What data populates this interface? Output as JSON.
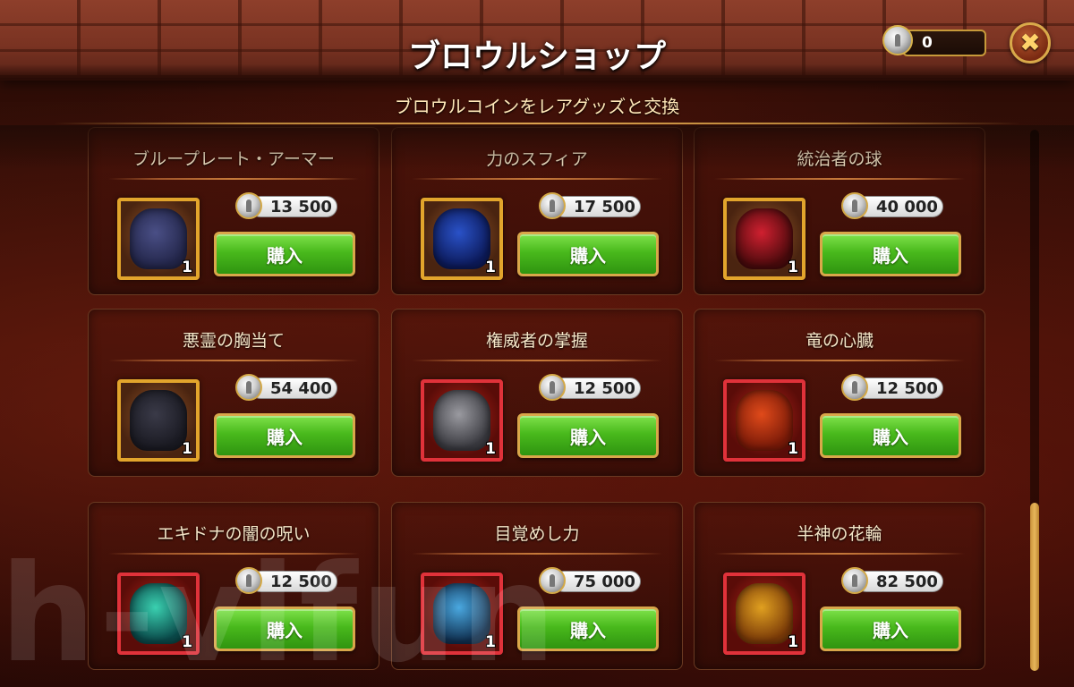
{
  "header": {
    "title": "ブロウルショップ",
    "subtitle": "ブロウルコインをレアグッズと交換",
    "coin_balance": "0",
    "close_icon": "close-icon",
    "colors": {
      "accent_gold": "#d9a74a",
      "buy_green": "#49b91c"
    }
  },
  "items": [
    {
      "name": "ブループレート・アーマー",
      "price": "13 500",
      "qty": "1",
      "buy_label": "購入",
      "frame": "gold",
      "icon": "blue-plate-armor-icon"
    },
    {
      "name": "力のスフィア",
      "price": "17 500",
      "qty": "1",
      "buy_label": "購入",
      "frame": "gold",
      "icon": "sphere-of-power-icon"
    },
    {
      "name": "統治者の球",
      "price": "40 000",
      "qty": "1",
      "buy_label": "購入",
      "frame": "gold",
      "icon": "rulers-orb-icon"
    },
    {
      "name": "悪霊の胸当て",
      "price": "54 400",
      "qty": "1",
      "buy_label": "購入",
      "frame": "gold",
      "icon": "evil-spirit-breastplate-icon"
    },
    {
      "name": "権威者の掌握",
      "price": "12 500",
      "qty": "1",
      "buy_label": "購入",
      "frame": "red",
      "icon": "authority-grasp-icon"
    },
    {
      "name": "竜の心臓",
      "price": "12 500",
      "qty": "1",
      "buy_label": "購入",
      "frame": "red",
      "icon": "dragon-heart-icon"
    },
    {
      "name": "エキドナの闇の呪い",
      "price": "12 500",
      "qty": "1",
      "buy_label": "購入",
      "frame": "red",
      "icon": "echidna-dark-curse-icon"
    },
    {
      "name": "目覚めし力",
      "price": "75 000",
      "qty": "1",
      "buy_label": "購入",
      "frame": "red",
      "icon": "awakened-power-icon"
    },
    {
      "name": "半神の花輪",
      "price": "82 500",
      "qty": "1",
      "buy_label": "購入",
      "frame": "red",
      "icon": "demigod-wreath-icon"
    }
  ],
  "scroll": {
    "position_fraction": 0.92
  },
  "watermark": "h-vifun"
}
